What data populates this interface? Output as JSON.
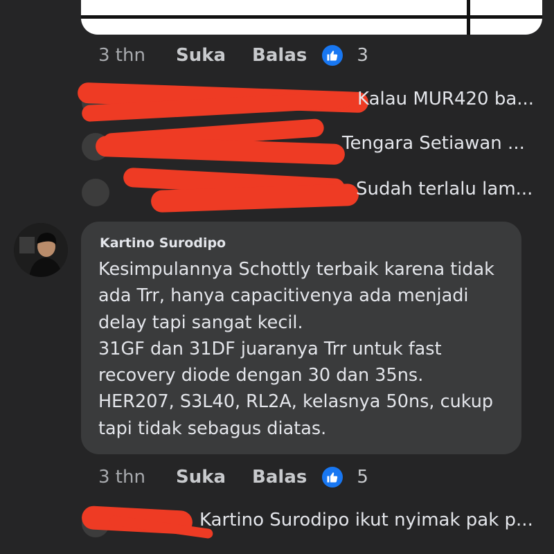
{
  "top_actions": {
    "time": "3 thn",
    "like_label": "Suka",
    "reply_label": "Balas",
    "reaction_count": "3"
  },
  "replies_top": [
    {
      "text": "Kalau MUR420 ba..."
    },
    {
      "text": "Tengara Setiawan ..."
    },
    {
      "text": "Sudah terlalu lam..."
    }
  ],
  "comment": {
    "author": "Kartino Surodipo",
    "lines": [
      "Kesimpulannya Schottly terbaik karena tidak",
      "ada Trr, hanya capacitivenya ada menjadi",
      "delay tapi sangat kecil.",
      "31GF dan 31DF juaranya Trr untuk fast",
      "recovery diode dengan 30 dan 35ns.",
      "HER207, S3L40, RL2A, kelasnya 50ns, cukup",
      "tapi tidak sebagus diatas."
    ]
  },
  "comment_actions": {
    "time": "3 thn",
    "like_label": "Suka",
    "reply_label": "Balas",
    "reaction_count": "5"
  },
  "reply_bottom": {
    "text": "Kartino Surodipo ikut nyimak pak p..."
  },
  "colors": {
    "background": "#252526",
    "bubble": "#3a3b3c",
    "accent": "#1877f2",
    "redaction": "#ee3b24"
  },
  "icons": {
    "reaction": "thumbs-up-icon"
  }
}
